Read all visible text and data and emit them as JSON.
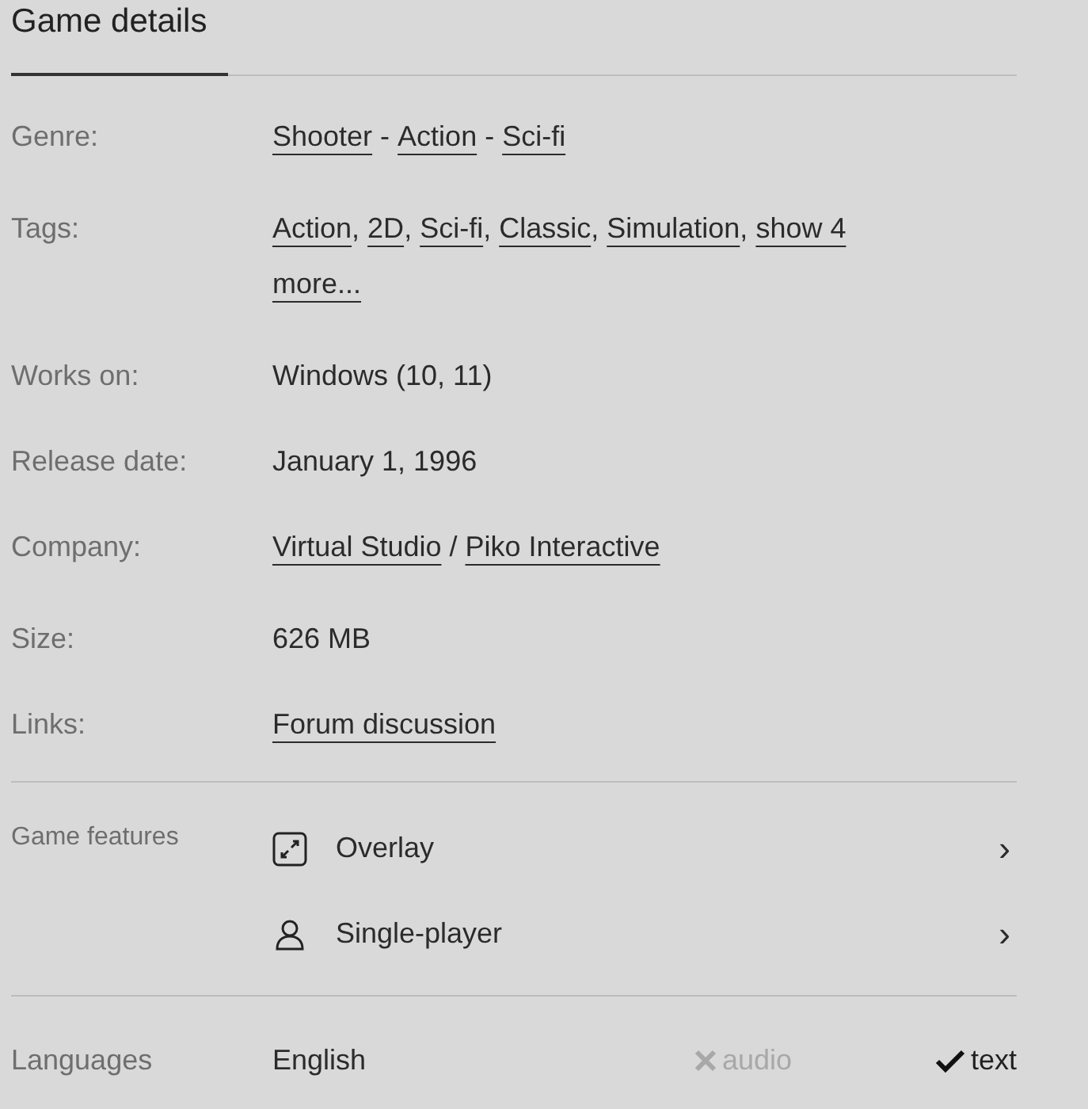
{
  "title": "Game details",
  "details": [
    {
      "label": "Genre:",
      "parts": [
        {
          "text": "Shooter",
          "link": true
        },
        {
          "text": " - ",
          "link": false
        },
        {
          "text": "Action",
          "link": true
        },
        {
          "text": " - ",
          "link": false
        },
        {
          "text": "Sci-fi",
          "link": true
        }
      ]
    },
    {
      "label": "Tags:",
      "parts": [
        {
          "text": "Action",
          "link": true
        },
        {
          "text": ", ",
          "link": false
        },
        {
          "text": "2D",
          "link": true
        },
        {
          "text": ", ",
          "link": false
        },
        {
          "text": "Sci-fi",
          "link": true
        },
        {
          "text": ", ",
          "link": false
        },
        {
          "text": "Classic",
          "link": true
        },
        {
          "text": ", ",
          "link": false
        },
        {
          "text": "Simulation",
          "link": true
        },
        {
          "text": ", ",
          "link": false
        },
        {
          "text": "show 4",
          "link": true
        },
        {
          "text": "more...",
          "link": true
        }
      ]
    },
    {
      "label": "Works on:",
      "parts": [
        {
          "text": "Windows (10, 11)",
          "link": false
        }
      ]
    },
    {
      "label": "Release date:",
      "parts": [
        {
          "text": "January 1, 1996",
          "link": false
        }
      ]
    },
    {
      "label": "Company:",
      "parts": [
        {
          "text": "Virtual Studio",
          "link": true
        },
        {
          "text": " / ",
          "link": false
        },
        {
          "text": "Piko Interactive",
          "link": true
        }
      ]
    },
    {
      "label": "Size:",
      "parts": [
        {
          "text": "626 MB",
          "link": false
        }
      ]
    },
    {
      "label": "Links:",
      "parts": [
        {
          "text": "Forum discussion",
          "link": true
        }
      ]
    }
  ],
  "features": {
    "label": "Game features",
    "items": [
      {
        "kind": "overlay",
        "text": "Overlay",
        "chevron": "›"
      },
      {
        "kind": "player",
        "text": "Single-player",
        "chevron": "›"
      }
    ]
  },
  "languages": {
    "label": "Languages",
    "items": [
      {
        "language": "English",
        "support": [
          {
            "text": "audio",
            "supported": false
          },
          {
            "text": "text",
            "supported": true
          }
        ]
      }
    ]
  }
}
